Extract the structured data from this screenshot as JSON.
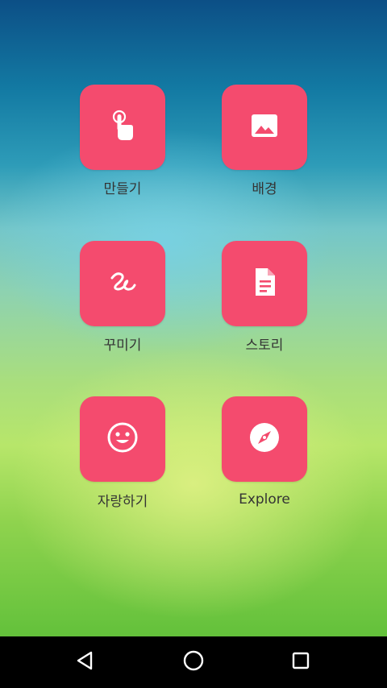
{
  "launcher": {
    "items": [
      {
        "label": "만들기",
        "icon": "touch-icon"
      },
      {
        "label": "배경",
        "icon": "image-icon"
      },
      {
        "label": "꾸미기",
        "icon": "scribble-icon"
      },
      {
        "label": "스토리",
        "icon": "document-icon"
      },
      {
        "label": "자랑하기",
        "icon": "smile-icon"
      },
      {
        "label": "Explore",
        "icon": "compass-icon"
      }
    ],
    "tile_color": "#f44b6e"
  },
  "navbar": {
    "buttons": [
      "back-icon",
      "home-icon",
      "recents-icon"
    ]
  }
}
